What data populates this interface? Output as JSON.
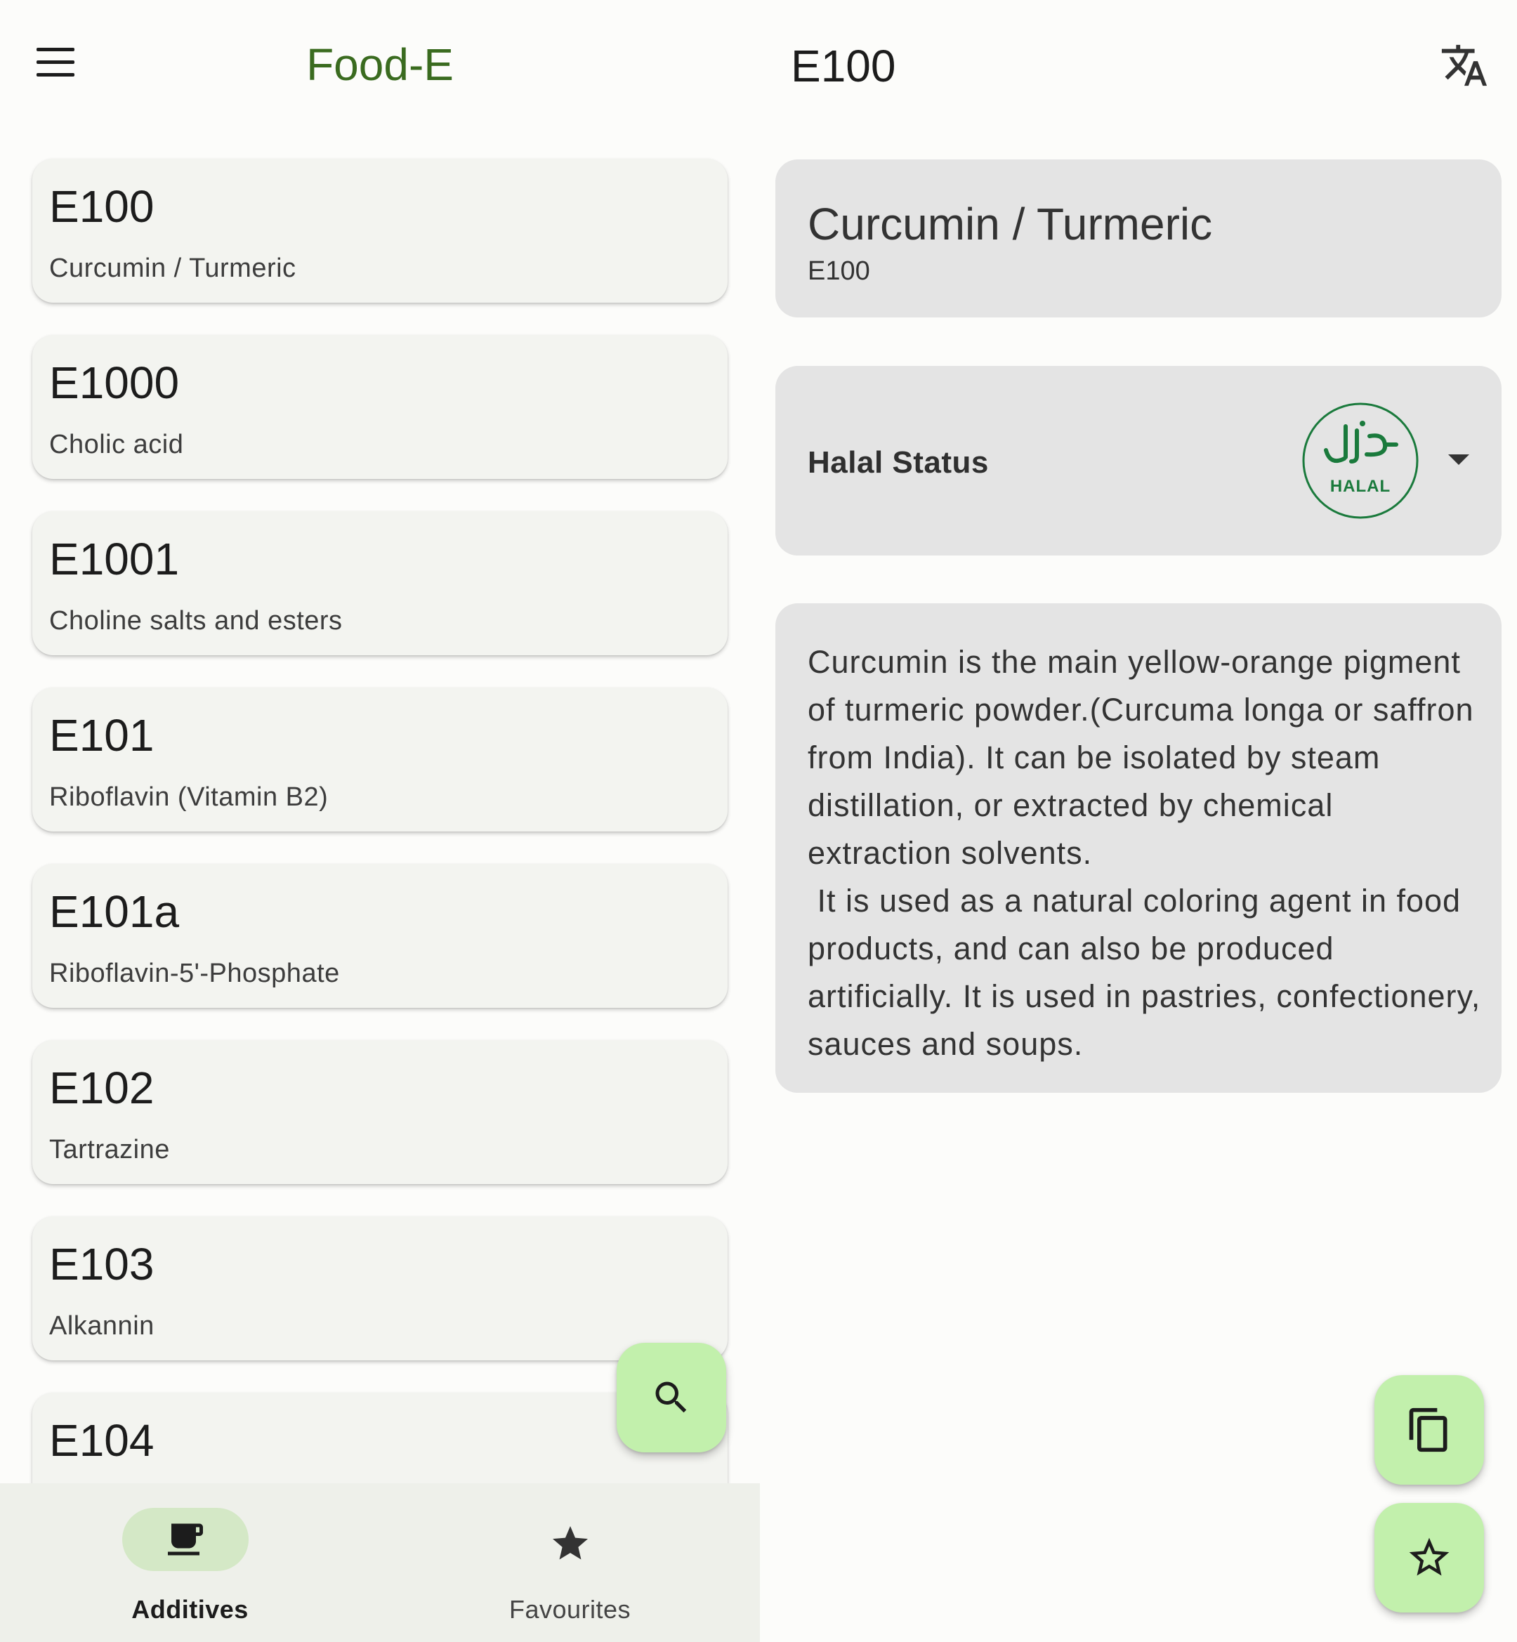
{
  "app": {
    "title": "Food-E"
  },
  "additives": [
    {
      "code": "E100",
      "name": "Curcumin / Turmeric"
    },
    {
      "code": "E1000",
      "name": "Cholic acid"
    },
    {
      "code": "E1001",
      "name": "Choline salts and esters"
    },
    {
      "code": "E101",
      "name": "Riboflavin (Vitamin B2)"
    },
    {
      "code": "E101a",
      "name": "Riboflavin-5'-Phosphate"
    },
    {
      "code": "E102",
      "name": "Tartrazine"
    },
    {
      "code": "E103",
      "name": "Alkannin"
    },
    {
      "code": "E104",
      "name": ""
    }
  ],
  "bottom_nav": {
    "items": [
      {
        "label": "Additives",
        "icon": "cup-icon",
        "active": true
      },
      {
        "label": "Favourites",
        "icon": "star-icon",
        "active": false
      }
    ]
  },
  "detail": {
    "title": "E100",
    "name": "Curcumin / Turmeric",
    "code": "E100",
    "halal_label": "Halal Status",
    "halal_badge_text": "HALAL",
    "description": "Curcumin is the main yellow-orange pigment of turmeric powder.(Curcuma longa or saffron from India). It can be isolated by steam distillation, or extracted by chemical extraction solvents.\n It is used as a natural coloring agent in food products, and can also be produced artificially. It is used in pastries, confectionery, sauces and soups."
  },
  "colors": {
    "accent": "#3a6b1f",
    "fab": "#c2f0ac",
    "card": "#f3f4f0",
    "detail_card": "#e4e4e4",
    "halal_green": "#1a7a3c"
  }
}
